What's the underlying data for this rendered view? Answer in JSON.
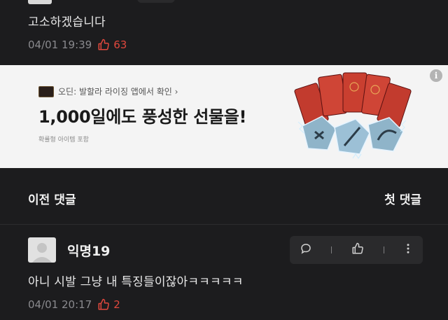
{
  "comment_top": {
    "text": "고소하겠습니다",
    "date": "04/01 19:39",
    "likes": "63"
  },
  "ad": {
    "source": "오딘: 발할라 라이징 앱에서 확인 ›",
    "headline": "1,000일에도 풍성한 선물을!",
    "disclaimer": "확률형 아이템 포함",
    "info_label": "i"
  },
  "nav": {
    "prev": "이전 댓글",
    "first": "첫 댓글"
  },
  "comment_second": {
    "author": "익명19",
    "text": "아니 시발 그냥 내 특징들이잖아ㅋㅋㅋㅋㅋ",
    "date": "04/01 20:17",
    "likes": "2"
  },
  "colors": {
    "background": "#1c1c1e",
    "like_red": "#e0483d",
    "ad_background": "#f4f4f4"
  },
  "icons": [
    "thumb-up-icon",
    "comment-bubble-icon",
    "more-vertical-icon",
    "info-icon"
  ]
}
